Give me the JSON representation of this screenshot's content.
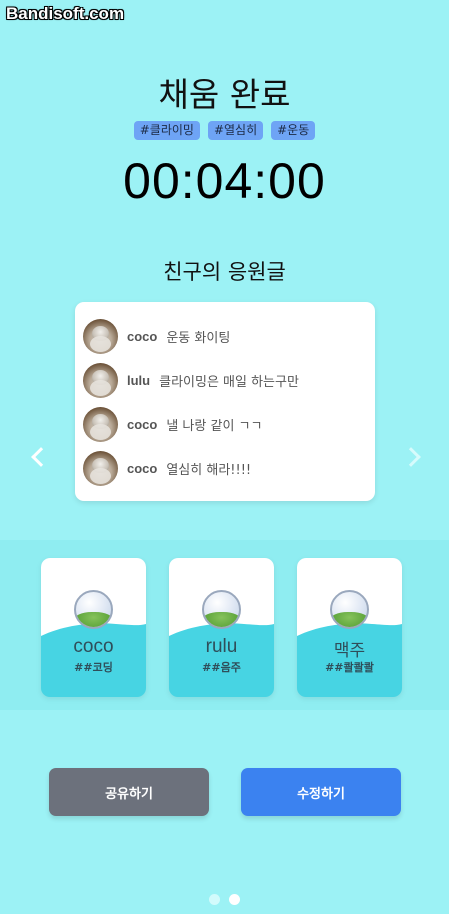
{
  "watermark": "Bandisoft.com",
  "title": "채움 완료",
  "tags": [
    "#클라이밍",
    "#열심히",
    "#운동"
  ],
  "timer": "00:04:00",
  "comments_title": "친구의 응원글",
  "comments": [
    {
      "user": "coco",
      "text": "운동 화이팅"
    },
    {
      "user": "lulu",
      "text": "클라이밍은 매일 하는구만"
    },
    {
      "user": "coco",
      "text": "낼 나랑 같이 ㄱㄱ"
    },
    {
      "user": "coco",
      "text": "열심히 해라!!!!"
    }
  ],
  "friends": [
    {
      "name": "coco",
      "tag": "##코딩"
    },
    {
      "name": "rulu",
      "tag": "##음주"
    },
    {
      "name": "맥주",
      "tag": "##콸콸콸"
    }
  ],
  "buttons": {
    "share": "공유하기",
    "edit": "수정하기"
  },
  "pager": {
    "count": 2,
    "active": 2
  },
  "icons": {
    "prev": "chevron-left-icon",
    "next": "chevron-right-icon",
    "avatar": "cat-avatar-icon",
    "globe": "globe-icon"
  },
  "colors": {
    "background": "#9cf2f5",
    "tag_bg": "#6ea4f5",
    "card_water": "#47d4e3",
    "share_button": "#6c717c",
    "edit_button": "#3b82f0"
  }
}
